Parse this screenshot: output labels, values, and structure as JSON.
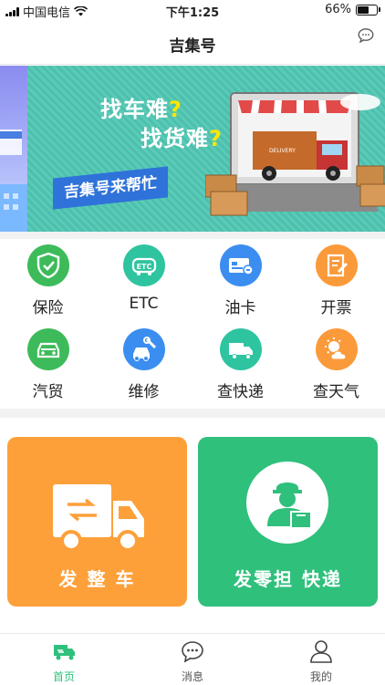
{
  "status_bar": {
    "carrier": "中国电信",
    "time": "下午1:25",
    "battery": "66%",
    "battery_level": 0.66,
    "wifi_icon": "wifi-icon"
  },
  "header": {
    "title": "吉集号",
    "message_icon": "chat-bubble-icon"
  },
  "banner": {
    "line1": "找车难",
    "line2": "找货难",
    "question_mark": "?",
    "tagline": "吉集号来帮忙",
    "page_count": 5,
    "active_page": 2
  },
  "services": [
    {
      "label": "保险",
      "icon": "shield-icon",
      "color": "#3dbb5a"
    },
    {
      "label": "ETC",
      "icon": "etc-car-icon",
      "color": "#2fc4a0"
    },
    {
      "label": "油卡",
      "icon": "fuel-card-icon",
      "color": "#3b8ef0"
    },
    {
      "label": "开票",
      "icon": "invoice-icon",
      "color": "#fb9a3a"
    },
    {
      "label": "汽贸",
      "icon": "car-icon",
      "color": "#3dbb5a"
    },
    {
      "label": "维修",
      "icon": "repair-icon",
      "color": "#3b8ef0"
    },
    {
      "label": "查快递",
      "icon": "delivery-truck-icon",
      "color": "#2fc4a0"
    },
    {
      "label": "查天气",
      "icon": "weather-icon",
      "color": "#fb9a3a"
    }
  ],
  "cards": {
    "full_truck": {
      "label": "发 整 车",
      "icon": "truck-icon",
      "color": "#fda03a"
    },
    "express": {
      "label": "发零担 快递",
      "icon": "courier-icon",
      "color": "#2fc07c"
    }
  },
  "tabs": [
    {
      "label": "首页",
      "icon": "home-truck-icon",
      "active": true
    },
    {
      "label": "消息",
      "icon": "message-icon",
      "active": false
    },
    {
      "label": "我的",
      "icon": "profile-icon",
      "active": false
    }
  ],
  "colors": {
    "accent_green": "#2fc07c",
    "accent_orange": "#fda03a"
  }
}
